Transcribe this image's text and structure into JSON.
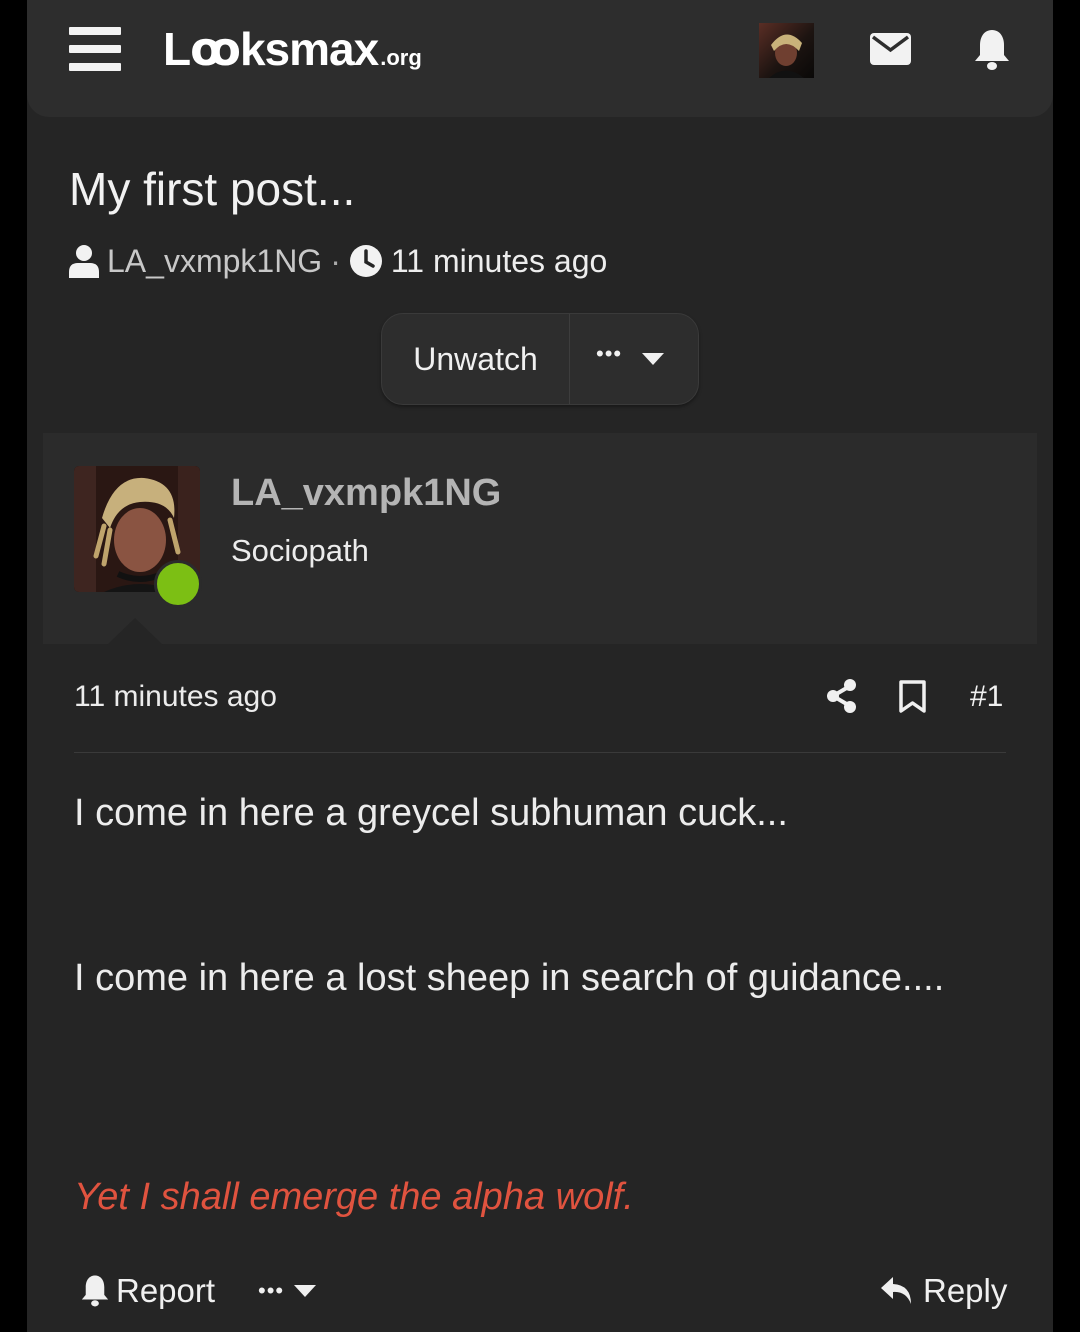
{
  "header": {
    "logo_main": "Lꝏksmax",
    "logo_suffix": ".org"
  },
  "thread": {
    "title": "My first post...",
    "author": "LA_vxmpk1NG",
    "separator": "·",
    "time": "11 minutes ago",
    "unwatch_label": "Unwatch",
    "more_label": "•••"
  },
  "post": {
    "username": "LA_vxmpk1NG",
    "user_title": "Sociopath",
    "time": "11 minutes ago",
    "number": "#1",
    "lines": [
      "I come in here a greycel subhuman cuck...",
      "I come in here a lost sheep in search of guidance...."
    ],
    "highlight_line": "Yet I shall emerge the alpha wolf.",
    "report_label": "Report",
    "more_label": "•••",
    "reply_label": "Reply"
  },
  "colors": {
    "background": "#252525",
    "header": "#2d2d2d",
    "online": "#7cbf14",
    "highlight_text": "#e0533f"
  },
  "icons": [
    "menu-icon",
    "mail-icon",
    "bell-icon",
    "user-icon",
    "clock-icon",
    "chevron-down-icon",
    "share-icon",
    "bookmark-icon",
    "reply-icon"
  ]
}
